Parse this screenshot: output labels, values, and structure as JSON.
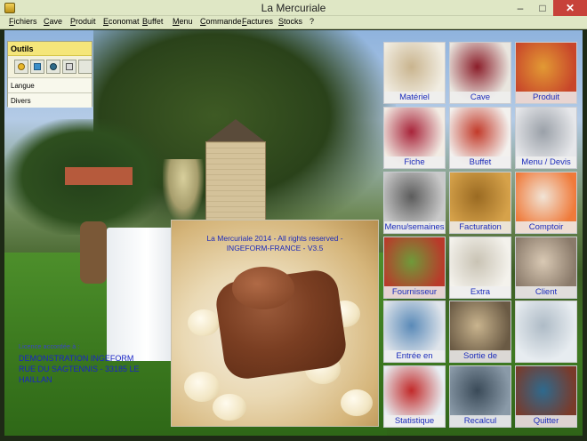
{
  "window": {
    "title": "La Mercuriale",
    "minimize": "–",
    "maximize": "□",
    "close": "✕"
  },
  "menu": [
    "Fichiers",
    "Cave",
    "Produit",
    "Economat",
    "Buffet",
    "Menu",
    "Commande",
    "Factures",
    "Stocks",
    "?"
  ],
  "tools_panel": {
    "header": "Outils",
    "icons": [
      "coin-icon",
      "money-icon",
      "user-icon",
      "calculator-icon",
      "blank-tool-icon"
    ],
    "rows": [
      "Langue",
      "Divers"
    ]
  },
  "company": {
    "label": "Licence accordée à :",
    "lines": [
      "DEMONSTRATION INGEFORM",
      "RUE DU SAGTENNIS - 33185 LE",
      "HAILLAN"
    ]
  },
  "splash": {
    "line1": "La Mercuriale 2014 - All rights reserved -",
    "line2": "INGEFORM-FRANCE - V3.5"
  },
  "tiles": [
    {
      "label": "Matériel",
      "colors": [
        "#f1ede2",
        "#c9b48e"
      ]
    },
    {
      "label": "Cave",
      "colors": [
        "#e9e6df",
        "#8b1e2a"
      ]
    },
    {
      "label": "Produit",
      "colors": [
        "#c8462a",
        "#e29a34"
      ]
    },
    {
      "label": "Fiche",
      "colors": [
        "#f2ece4",
        "#a8243a"
      ]
    },
    {
      "label": "Buffet",
      "colors": [
        "#f3f1ee",
        "#c23a2a"
      ]
    },
    {
      "label": "Menu / Devis",
      "colors": [
        "#e6e7ea",
        "#9aa0a8"
      ]
    },
    {
      "label": "Menu/semaines",
      "colors": [
        "#c9c9c9",
        "#5c5c5c"
      ]
    },
    {
      "label": "Facturation",
      "colors": [
        "#d6a24a",
        "#9a6a22"
      ]
    },
    {
      "label": "Comptoir",
      "colors": [
        "#ef7a3a",
        "#f1e4d6"
      ]
    },
    {
      "label": "Fournisseur",
      "colors": [
        "#b93a2a",
        "#6f9a3a"
      ]
    },
    {
      "label": "Extra",
      "colors": [
        "#f4f2ec",
        "#c9c3b4"
      ]
    },
    {
      "label": "Client",
      "colors": [
        "#8a7a6a",
        "#d9c9b4"
      ]
    },
    {
      "label": "Entrée en",
      "colors": [
        "#dfe4ea",
        "#5a8ab8"
      ]
    },
    {
      "label": "Sortie de",
      "colors": [
        "#6a5a44",
        "#c9b48e"
      ]
    },
    {
      "label": "",
      "colors": [
        "#e7ecf0",
        "#aebbc6"
      ]
    },
    {
      "label": "Statistique",
      "colors": [
        "#e7eef2",
        "#c22a2a"
      ]
    },
    {
      "label": "Recalcul",
      "colors": [
        "#8a9aa8",
        "#3a4a58"
      ]
    },
    {
      "label": "Quitter",
      "colors": [
        "#7a3a2a",
        "#2e6a8e"
      ]
    }
  ]
}
